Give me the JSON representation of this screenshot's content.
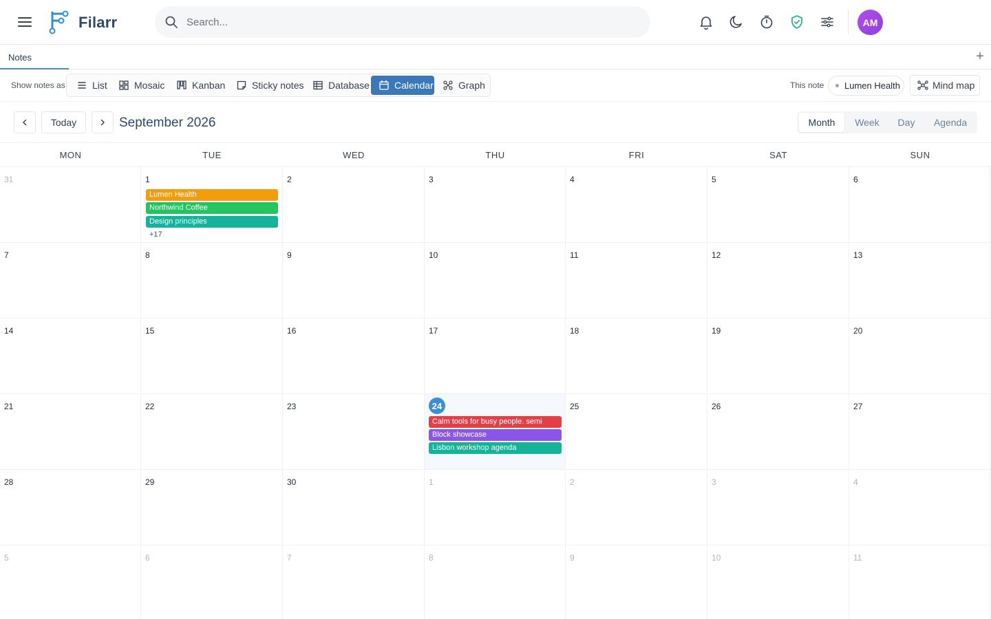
{
  "app": {
    "brand": "Filarr",
    "search_placeholder": "Search...",
    "avatar_initials": "AM",
    "accent": "#3a78b8",
    "shield_color": "#22b07d"
  },
  "tabs": {
    "active": "Notes"
  },
  "views": {
    "label": "Show notes as",
    "items": [
      "List",
      "Mosaic",
      "Kanban",
      "Sticky notes",
      "Database",
      "Calendar",
      "Graph"
    ],
    "selected": "Calendar",
    "this_note_label": "This note",
    "this_note_value": "Lumen Health",
    "mind_map_label": "Mind map"
  },
  "calendar": {
    "today_label": "Today",
    "title": "September 2026",
    "range_options": [
      "Month",
      "Week",
      "Day",
      "Agenda"
    ],
    "selected_range": "Month",
    "weekdays": [
      "MON",
      "TUE",
      "WED",
      "THU",
      "FRI",
      "SAT",
      "SUN"
    ],
    "weeks": [
      [
        "31",
        "1",
        "2",
        "3",
        "4",
        "5",
        "6"
      ],
      [
        "7",
        "8",
        "9",
        "10",
        "11",
        "12",
        "13"
      ],
      [
        "14",
        "15",
        "16",
        "17",
        "18",
        "19",
        "20"
      ],
      [
        "21",
        "22",
        "23",
        "24",
        "25",
        "26",
        "27"
      ],
      [
        "28",
        "29",
        "30",
        "1",
        "2",
        "3",
        "4"
      ],
      [
        "5",
        "6",
        "7",
        "8",
        "9",
        "10",
        "11"
      ]
    ],
    "today": "24",
    "events_sep_1": [
      {
        "title": "Lumen Health",
        "color": "#f29d0c"
      },
      {
        "title": "Northwind Coffee",
        "color": "#22c55e"
      },
      {
        "title": "Design principles",
        "color": "#15b39c"
      }
    ],
    "events_sep_1_more": "+17",
    "events_sep_24": [
      {
        "title": "Calm tools for busy people. semi",
        "color": "#e43e46"
      },
      {
        "title": "Block showcase",
        "color": "#8b55e8"
      },
      {
        "title": "Lisbon workshop agenda",
        "color": "#15b39c"
      }
    ]
  }
}
